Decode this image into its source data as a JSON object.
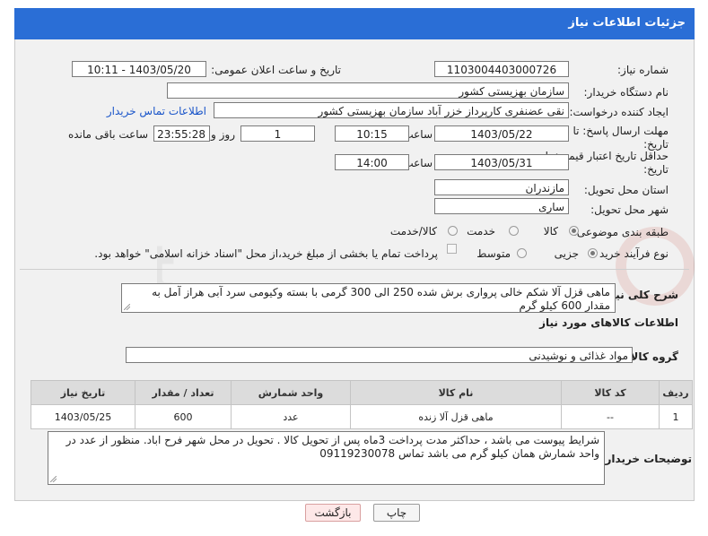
{
  "header": {
    "title": "جزئیات اطلاعات نیاز"
  },
  "fields": {
    "need_number_label": "شماره نیاز:",
    "need_number": "1103004403000726",
    "announce_label": "تاریخ و ساعت اعلان عمومی:",
    "announce_value": "1403/05/20 - 10:11",
    "buyer_org_label": "نام دستگاه خریدار:",
    "buyer_org": "سازمان بهزیستی کشور",
    "requester_label": "ایجاد کننده درخواست:",
    "requester": "نقی عضنفری کارپرداز خزر آباد سازمان بهزیستی کشور",
    "contact_link": "اطلاعات تماس خریدار",
    "deadline_label": "مهلت ارسال پاسخ: تا تاریخ:",
    "deadline_date": "1403/05/22",
    "time_label": "ساعت",
    "deadline_time": "10:15",
    "days_value": "1",
    "days_label": "روز و",
    "remaining_time": "23:55:28",
    "remaining_label": "ساعت باقی مانده",
    "validity_label": "حداقل تاریخ اعتبار قیمت: تا تاریخ:",
    "validity_date": "1403/05/31",
    "validity_time_label": "ساعت",
    "validity_time": "14:00",
    "province_label": "استان محل تحویل:",
    "province": "مازندران",
    "city_label": "شهر محل تحویل:",
    "city": "ساری",
    "category_label": "طبقه بندی موضوعی:",
    "category_options": [
      "کالا",
      "خدمت",
      "کالا/خدمت"
    ],
    "process_label": "نوع فرآیند خرید :",
    "process_options": [
      "جزیی",
      "متوسط"
    ],
    "treasury_note": "پرداخت تمام یا بخشی از مبلغ خرید،از محل \"اسناد خزانه اسلامی\" خواهد بود."
  },
  "description": {
    "label": "شرح کلی نیاز:",
    "text": "ماهی قزل آلا شکم خالی پرواری برش شده 250 الی 300 گرمی با بسته وکیومی سرد آبی هراز آمل به مقدار 600 کیلو گرم"
  },
  "goods_info": {
    "title": "اطلاعات کالاهای مورد نیاز",
    "group_label": "گروه کالا:",
    "group_value": "مواد غذائی و نوشیدنی"
  },
  "table": {
    "headers": [
      "ردیف",
      "کد کالا",
      "نام کالا",
      "واحد شمارش",
      "تعداد / مقدار",
      "تاریخ نیاز"
    ],
    "rows": [
      [
        "1",
        "--",
        "ماهی قزل آلا زنده",
        "عدد",
        "600",
        "1403/05/25"
      ]
    ]
  },
  "buyer_notes": {
    "label": "توضیحات خریدار:",
    "text": "شرایط پیوست می باشد ، حداکثر مدت پرداخت 3ماه پس از تحویل کالا . تحویل در محل شهر فرح اباد. منظور از عدد در واحد شمارش همان کیلو گرم می باشد تماس 09119230078"
  },
  "buttons": {
    "print": "چاپ",
    "back": "بازگشت"
  },
  "colors": {
    "header": "#2a6ed6",
    "link": "#1a55c9",
    "back_button": "#fde8e8"
  }
}
